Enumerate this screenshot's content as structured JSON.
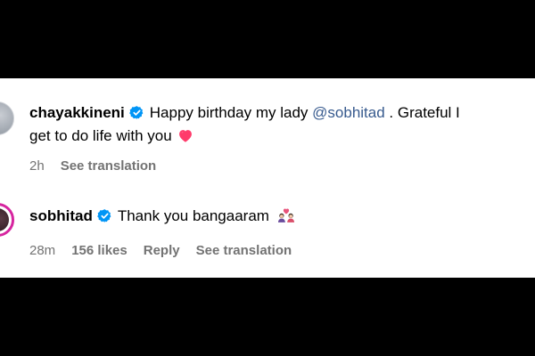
{
  "colors": {
    "background": "#000000",
    "panel": "#ffffff",
    "text": "#000000",
    "meta": "#737373",
    "mention": "#375a8e",
    "verified": "#0095f6",
    "heart": "#ff3b6b"
  },
  "comments": [
    {
      "username": "chayakkineni",
      "verified_icon": "verified-badge-icon",
      "text_before": "Happy birthday my lady ",
      "mention": "@sobhitad",
      "text_after": " . Grateful I",
      "text_line2": "get to do life with you",
      "emoji": "heart-icon",
      "time": "2h",
      "see_translation": "See translation"
    },
    {
      "username": "sobhitad",
      "verified_icon": "verified-badge-icon",
      "text": "Thank you bangaaram",
      "emoji": "couple-emoji-icon",
      "time": "28m",
      "likes": "156 likes",
      "reply": "Reply",
      "see_translation": "See translation"
    }
  ]
}
